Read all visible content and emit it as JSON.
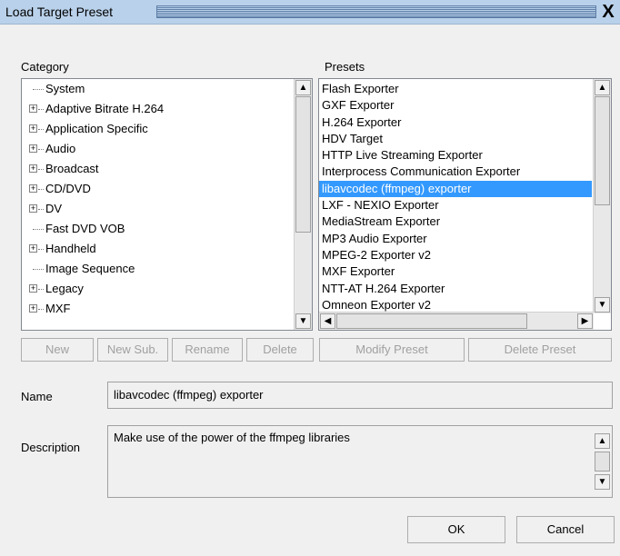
{
  "window": {
    "title": "Load  Target Preset",
    "close_glyph": "X"
  },
  "category": {
    "label": "Category",
    "items": [
      {
        "label": "System",
        "expandable": false
      },
      {
        "label": "Adaptive Bitrate H.264",
        "expandable": true
      },
      {
        "label": "Application Specific",
        "expandable": true
      },
      {
        "label": "Audio",
        "expandable": true
      },
      {
        "label": "Broadcast",
        "expandable": true
      },
      {
        "label": "CD/DVD",
        "expandable": true
      },
      {
        "label": "DV",
        "expandable": true
      },
      {
        "label": "Fast DVD VOB",
        "expandable": false
      },
      {
        "label": "Handheld",
        "expandable": true
      },
      {
        "label": "Image Sequence",
        "expandable": false
      },
      {
        "label": "Legacy",
        "expandable": true
      },
      {
        "label": "MXF",
        "expandable": true
      }
    ]
  },
  "presets": {
    "label": "Presets",
    "items": [
      {
        "label": "Flash Exporter",
        "selected": false
      },
      {
        "label": "GXF Exporter",
        "selected": false
      },
      {
        "label": "H.264 Exporter",
        "selected": false
      },
      {
        "label": "HDV Target",
        "selected": false
      },
      {
        "label": "HTTP Live Streaming Exporter",
        "selected": false
      },
      {
        "label": "Interprocess Communication Exporter",
        "selected": false
      },
      {
        "label": "libavcodec (ffmpeg) exporter",
        "selected": true
      },
      {
        "label": "LXF - NEXIO Exporter",
        "selected": false
      },
      {
        "label": "MediaStream Exporter",
        "selected": false
      },
      {
        "label": "MP3 Audio Exporter",
        "selected": false
      },
      {
        "label": "MPEG-2 Exporter v2",
        "selected": false
      },
      {
        "label": "MXF Exporter",
        "selected": false
      },
      {
        "label": "NTT-AT H.264 Exporter",
        "selected": false
      },
      {
        "label": "Omneon Exporter v2",
        "selected": false
      }
    ]
  },
  "category_buttons": {
    "new": "New",
    "new_sub": "New Sub.",
    "rename": "Rename",
    "delete": "Delete"
  },
  "preset_buttons": {
    "modify": "Modify Preset",
    "delete": "Delete Preset"
  },
  "name": {
    "label": "Name",
    "value": "libavcodec (ffmpeg) exporter"
  },
  "description": {
    "label": "Description",
    "value": "Make use of the power of the ffmpeg libraries"
  },
  "footer": {
    "ok": "OK",
    "cancel": "Cancel"
  },
  "icons": {
    "up": "▲",
    "down": "▼",
    "left": "◀",
    "right": "▶",
    "expand": "+",
    "close": "X"
  },
  "colors": {
    "titlebar": "#b9d1ea",
    "selection": "#3399ff",
    "dialog_bg": "#f0f0f0"
  }
}
